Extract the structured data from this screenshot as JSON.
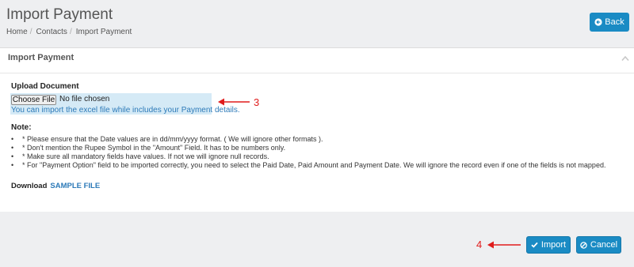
{
  "header": {
    "title": "Import Payment",
    "breadcrumb": [
      "Home",
      "Contacts",
      "Import Payment"
    ],
    "back_label": "Back"
  },
  "panel": {
    "title": "Import Payment",
    "upload": {
      "label": "Upload Document",
      "file_button": "Choose File",
      "file_status": "No file chosen",
      "help": "You can import the excel file while includes your Payment details."
    },
    "note": {
      "label": "Note:",
      "bullet": "•",
      "items": [
        "* Please ensure that the Date values are in dd/mm/yyyy format. ( We will ignore other formats ).",
        "* Don't mention the Rupee Symbol in the \"Amount\" Field. It has to be numbers only.",
        "* Make sure all mandatory fields have values. If not we will ignore null records.",
        "* For \"Payment Option\" field to be imported correctly, you need to select the Paid Date, Paid Amount and Payment Date. We will ignore the record even if one of the fields is not mapped."
      ]
    },
    "download": {
      "label": "Download",
      "link": "SAMPLE FILE"
    }
  },
  "actions": {
    "import_label": "Import",
    "cancel_label": "Cancel"
  },
  "annotations": {
    "upload_number": "3",
    "import_number": "4"
  },
  "colors": {
    "primary": "#1a8bc4",
    "link": "#2d7ab8",
    "upload_highlight": "#d5eaf6",
    "annotation": "#e01c1c"
  }
}
